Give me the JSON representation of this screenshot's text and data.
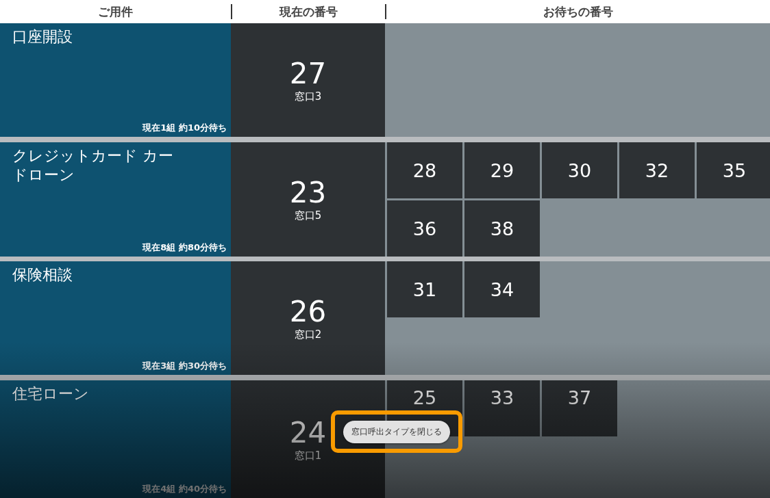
{
  "header": {
    "columns": [
      "ご用件",
      "現在の番号",
      "お待ちの番号"
    ]
  },
  "services": [
    {
      "name": "口座開設",
      "current_number": "27",
      "counter": "窓口3",
      "wait": "現在**1**組 約**10**分待ち"
    },
    {
      "name": "クレジットカード カードローン",
      "current_number": "23",
      "counter": "窓口5",
      "wait": "現在**8**組 約**80**分待ち",
      "waiting_numbers": [
        "28",
        "29",
        "30",
        "32",
        "35",
        "36",
        "38"
      ]
    },
    {
      "name": "保険相談",
      "current_number": "26",
      "counter": "窓口2",
      "wait": "現在**3**組 約**30**分待ち",
      "waiting_numbers": [
        "31",
        "34"
      ]
    },
    {
      "name": "住宅ローン",
      "current_number": "24",
      "counter": "窓口1",
      "wait": "現在**4**組 約**40**分待ち",
      "waiting_numbers": [
        "25",
        "33",
        "37"
      ]
    }
  ],
  "close_button": {
    "label": "窓口呼出タイプを閉じる"
  }
}
